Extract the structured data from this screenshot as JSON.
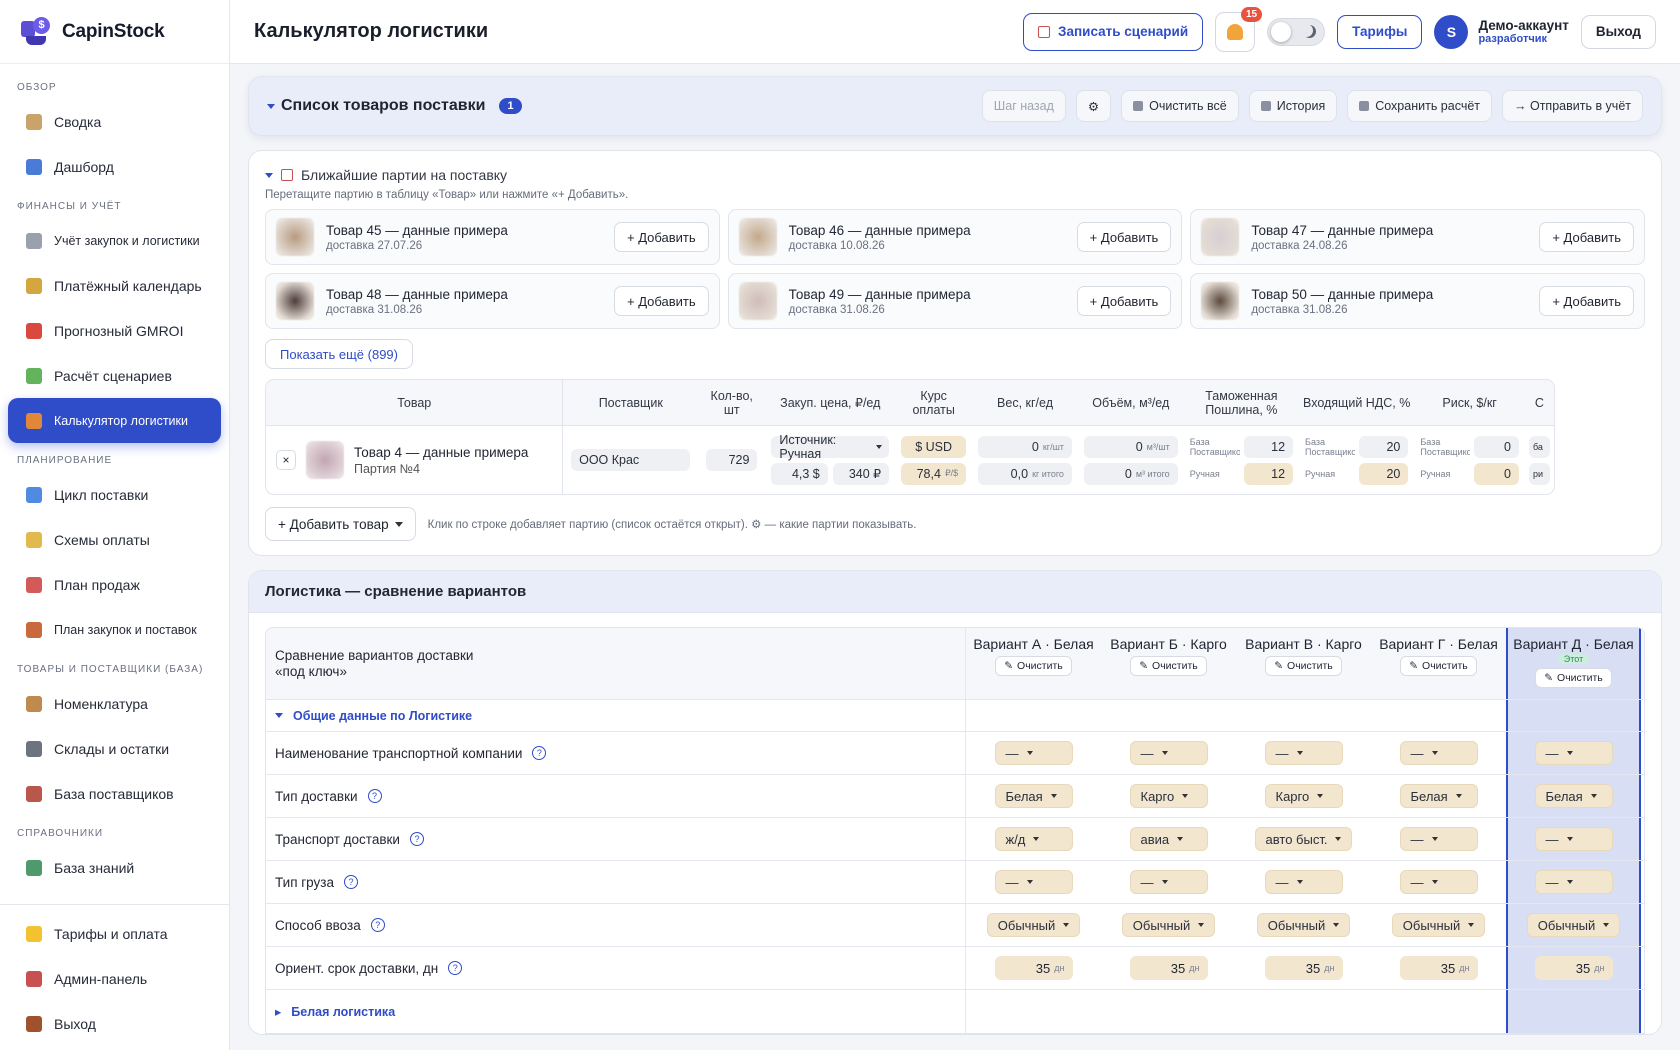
{
  "brand": {
    "name": "CapinStock",
    "logo_glyph": "$"
  },
  "sidebar": {
    "sections": [
      {
        "title": "ОБЗОР",
        "items": [
          {
            "label": "Сводка",
            "icon": "notebook-icon",
            "color": "#c9a36a"
          },
          {
            "label": "Дашборд",
            "icon": "bar-chart-icon",
            "color": "#4a7bd6"
          }
        ]
      },
      {
        "title": "ФИНАНСЫ И УЧЁТ",
        "items": [
          {
            "label": "Учёт закупок и логистики",
            "icon": "receipt-icon",
            "color": "#9aa0ad"
          },
          {
            "label": "Платёжный календарь",
            "icon": "money-bag-icon",
            "color": "#d3a640"
          },
          {
            "label": "Прогнозный GMROI",
            "icon": "target-icon",
            "color": "#d9493f"
          },
          {
            "label": "Расчёт сценариев",
            "icon": "test-tube-icon",
            "color": "#62b35b"
          },
          {
            "label": "Калькулятор логистики",
            "icon": "truck-icon",
            "color": "#e0873a",
            "active": true
          }
        ]
      },
      {
        "title": "ПЛАНИРОВАНИЕ",
        "items": [
          {
            "label": "Цикл поставки",
            "icon": "cycle-icon",
            "color": "#4f8be0"
          },
          {
            "label": "Схемы оплаты",
            "icon": "card-icon",
            "color": "#e2b94c"
          },
          {
            "label": "План продаж",
            "icon": "line-chart-icon",
            "color": "#d45a5a"
          },
          {
            "label": "План закупок и поставок",
            "icon": "bricks-icon",
            "color": "#c96a3e"
          }
        ]
      },
      {
        "title": "ТОВАРЫ И ПОСТАВЩИКИ (БАЗА)",
        "items": [
          {
            "label": "Номенклатура",
            "icon": "box-icon",
            "color": "#c08a4e"
          },
          {
            "label": "Склады и остатки",
            "icon": "building-icon",
            "color": "#6d7480"
          },
          {
            "label": "База поставщиков",
            "icon": "factory-icon",
            "color": "#b8574a"
          }
        ]
      },
      {
        "title": "СПРАВОЧНИКИ",
        "items": [
          {
            "label": "База знаний",
            "icon": "books-icon",
            "color": "#4f9a6a"
          }
        ]
      }
    ],
    "bottom": [
      {
        "label": "Тарифы и оплата",
        "icon": "star-icon",
        "color": "#f2c230"
      },
      {
        "label": "Админ-панель",
        "icon": "shield-icon",
        "color": "#c85050"
      },
      {
        "label": "Выход",
        "icon": "door-icon",
        "color": "#a0522d"
      }
    ]
  },
  "topbar": {
    "title": "Калькулятор логистики",
    "record_label": "Записать сценарий",
    "notif_count": "15",
    "tariffs_label": "Тарифы",
    "user_initial": "S",
    "user_name": "Демо-аккаунт",
    "user_role": "разработчик",
    "exit_label": "Выход"
  },
  "supply": {
    "title": "Список товаров поставки",
    "count": "1",
    "tools": [
      "Шаг назад",
      "Очистить всё",
      "История",
      "Сохранить расчёт",
      "→ Отправить в учёт"
    ],
    "settings_glyph": "⚙"
  },
  "parties": {
    "title": "Ближайшие партии на поставку",
    "hint": "Перетащите партию в таблицу «Товар» или нажмите «+ Добавить».",
    "add_label": "+ Добавить",
    "items": [
      {
        "name": "Товар 45 — данные примера",
        "date": "доставка 27.07.26"
      },
      {
        "name": "Товар 46 — данные примера",
        "date": "доставка 10.08.26"
      },
      {
        "name": "Товар 47 — данные примера",
        "date": "доставка 24.08.26"
      },
      {
        "name": "Товар 48 — данные примера",
        "date": "доставка 31.08.26"
      },
      {
        "name": "Товар 49 — данные примера",
        "date": "доставка 31.08.26"
      },
      {
        "name": "Товар 50 — данные примера",
        "date": "доставка 31.08.26"
      }
    ],
    "show_more": "Показать ещё (899)"
  },
  "product_table": {
    "headers": [
      "Товар",
      "Поставщик",
      "Кол-во, шт",
      "Закуп. цена, ₽/ед",
      "Курс оплаты",
      "Вес, кг/ед",
      "Объём, м³/ед",
      "Таможенная Пошлина, %",
      "Входящий НДС, %",
      "Риск, $/кг",
      "С"
    ],
    "row": {
      "remove": "×",
      "name": "Товар 4 — данные примера",
      "party": "Партия №4",
      "supplier": "ООО Крас",
      "qty": "729",
      "source": "Источник: Ручная",
      "price_usd": "4,3 $",
      "price_rub": "340 ₽",
      "currency": "$ USD",
      "rate": "78,4",
      "rate_unit": "₽/$",
      "weight": "0",
      "weight_unit": "кг/шт",
      "weight_total": "0,0",
      "weight_total_unit": "кг итого",
      "volume": "0",
      "volume_unit": "м³/шт",
      "volume_total": "0",
      "volume_total_unit": "м³ итого",
      "base_label": "База Поставщиков",
      "manual_label": "Ручная",
      "duty_base": "12",
      "duty_manual": "12",
      "vat_base": "20",
      "vat_manual": "20",
      "risk_base": "0",
      "risk_manual": "0",
      "extra_top": "ба",
      "extra_bottom": "ри"
    },
    "add_product": "+ Добавить товар",
    "add_hint": "Клик по строке добавляет партию (список остаётся открыт). ⚙ — какие партии показывать."
  },
  "compare": {
    "title": "Логистика — сравнение вариантов",
    "corner": "Сравнение вариантов доставки «под ключ»",
    "clear_label": "Очистить",
    "this_label": "Этот",
    "variants": [
      "Вариант А · Белая",
      "Вариант Б · Карго",
      "Вариант В · Карго",
      "Вариант Г · Белая",
      "Вариант Д · Белая"
    ],
    "section": "Общие данные по Логистике",
    "rows": [
      {
        "label": "Наименование транспортной компании",
        "values": [
          "—",
          "—",
          "—",
          "—",
          "—"
        ],
        "kind": "dd"
      },
      {
        "label": "Тип доставки",
        "values": [
          "Белая",
          "Карго",
          "Карго",
          "Белая",
          "Белая"
        ],
        "kind": "dd"
      },
      {
        "label": "Транспорт доставки",
        "values": [
          "ж/д",
          "авиа",
          "авто быст.",
          "—",
          "—"
        ],
        "kind": "dd"
      },
      {
        "label": "Тип груза",
        "values": [
          "—",
          "—",
          "—",
          "—",
          "—"
        ],
        "kind": "dd"
      },
      {
        "label": "Способ ввоза",
        "values": [
          "Обычный",
          "Обычный",
          "Обычный",
          "Обычный",
          "Обычный"
        ],
        "kind": "dd"
      },
      {
        "label": "Ориент. срок доставки, дн",
        "values": [
          "35",
          "35",
          "35",
          "35",
          "35"
        ],
        "unit": "дн",
        "kind": "num"
      }
    ],
    "next_section": "Белая логистика"
  },
  "accent": "#2f4cc9"
}
